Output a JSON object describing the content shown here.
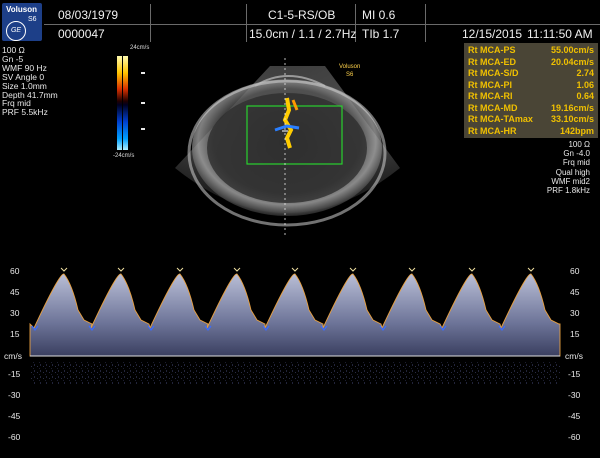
{
  "header": {
    "brand": "Voluson",
    "model": "S6",
    "ge_logo": "GE",
    "date_of_birth": "08/03/1979",
    "patient_id": "0000047",
    "probe": "C1-5-RS/OB",
    "depth_info": "15.0cm / 1.1 / 2.7Hz",
    "mi": "MI 0.6",
    "tib": "TIb 1.7",
    "exam_date": "12/15/2015",
    "exam_time": "11:11:50 AM"
  },
  "left_params": [
    "100 Ω",
    "Gn -5",
    "WMF 90 Hz",
    "SV Angle 0",
    "Size 1.0mm",
    "Depth 41.7mm",
    "Frq mid",
    "PRF 5.5kHz"
  ],
  "colorbar": {
    "top_label": "24cm/s",
    "bottom_label": "-24cm/s"
  },
  "image_overlay": {
    "brand": "Voluson",
    "model": "S6"
  },
  "measurements": [
    {
      "label": "Rt MCA-PS",
      "value": "55.00cm/s"
    },
    {
      "label": "Rt MCA-ED",
      "value": "20.04cm/s"
    },
    {
      "label": "Rt MCA-S/D",
      "value": "2.74"
    },
    {
      "label": "Rt MCA-PI",
      "value": "1.06"
    },
    {
      "label": "Rt MCA-RI",
      "value": "0.64"
    },
    {
      "label": "Rt MCA-MD",
      "value": "19.16cm/s"
    },
    {
      "label": "Rt MCA-TAmax",
      "value": "33.10cm/s"
    },
    {
      "label": "Rt MCA-HR",
      "value": "142bpm"
    }
  ],
  "doppler_params": [
    "100 Ω",
    "Gn -4.0",
    "Frq mid",
    "Qual high",
    "WMF mid2",
    "PRF 1.8kHz"
  ],
  "velocity_scale": {
    "unit": "cm/s",
    "positive_ticks": [
      "60",
      "45",
      "30",
      "15"
    ],
    "negative_ticks": [
      "-15",
      "-30",
      "-45",
      "-60"
    ]
  },
  "colors": {
    "measurement_text": "#f0c000",
    "measurement_bg": "#4a4536",
    "logo_bg": "#1d3f88",
    "roi_box": "#29d12e",
    "trace_envelope": "#e8a040",
    "overlay_text": "#ffd24a"
  }
}
